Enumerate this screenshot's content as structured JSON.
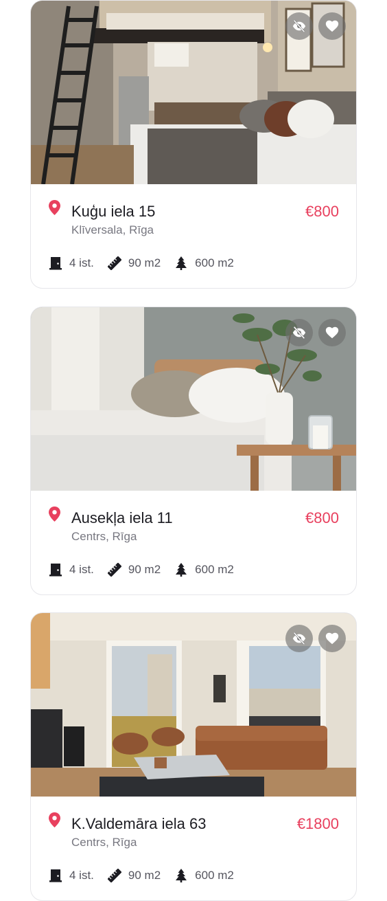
{
  "listings": [
    {
      "address": "Kuģu iela 15",
      "district": "Klīversala, Rīga",
      "price": "€800",
      "rooms": "4 ist.",
      "area": "90 m2",
      "land": "600 m2",
      "photo_icons": [
        "eye-off-icon",
        "heart-icon"
      ]
    },
    {
      "address": "Ausekļa iela 11",
      "district": "Centrs, Rīga",
      "price": "€800",
      "rooms": "4 ist.",
      "area": "90 m2",
      "land": "600 m2",
      "photo_icons": [
        "eye-off-icon",
        "heart-icon"
      ]
    },
    {
      "address": "K.Valdemāra iela 63",
      "district": "Centrs, Rīga",
      "price": "€1800",
      "rooms": "4 ist.",
      "area": "90 m2",
      "land": "600 m2",
      "photo_icons": [
        "eye-off-icon",
        "heart-icon"
      ]
    }
  ],
  "colors": {
    "accent": "#e8405e",
    "card_border": "#e6e6ea",
    "secondary_text": "#777780",
    "icon_dark": "#1c1c22"
  }
}
